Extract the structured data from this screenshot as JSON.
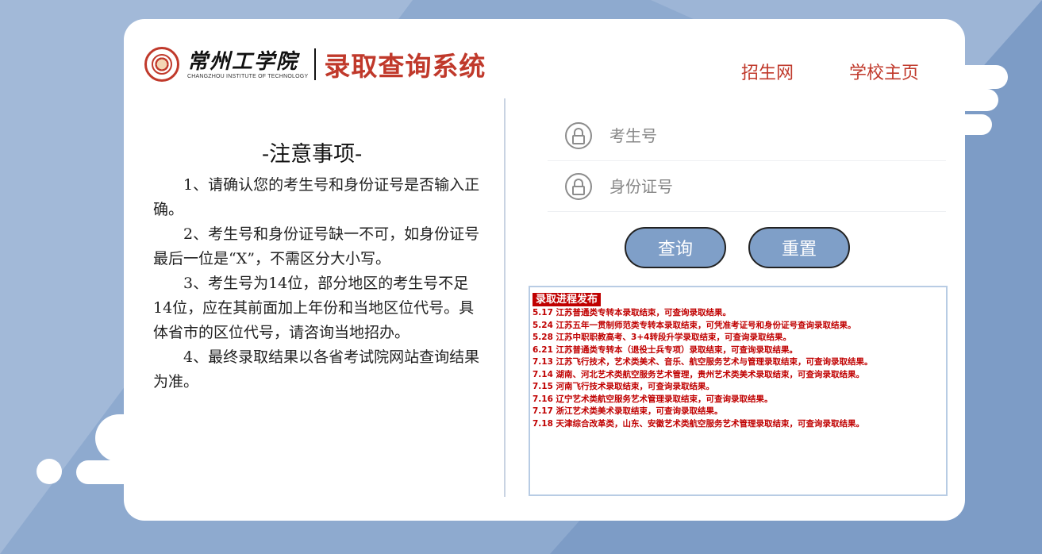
{
  "header": {
    "school_name_cn": "常州工学院",
    "school_name_en": "CHANGZHOU INSTITUTE OF TECHNOLOGY",
    "system_title": "录取查询系统",
    "seal_icon": "school-seal-icon"
  },
  "nav": {
    "items": [
      {
        "label": "招生网"
      },
      {
        "label": "学校主页"
      }
    ]
  },
  "notes": {
    "title": "-注意事项-",
    "items": [
      "1、请确认您的考生号和身份证号是否输入正确。",
      "2、考生号和身份证号缺一不可，如身份证号最后一位是“X”，不需区分大小写。",
      "3、考生号为14位，部分地区的考生号不足14位，应在其前面加上年份和当地区位代号。具体省市的区位代号，请咨询当地招办。",
      "4、最终录取结果以各省考试院网站查询结果为准。"
    ]
  },
  "form": {
    "exam_no_placeholder": "考生号",
    "id_no_placeholder": "身份证号",
    "exam_no_value": "",
    "id_no_value": "",
    "query_label": "查询",
    "reset_label": "重置",
    "field_icon": "lock-icon"
  },
  "news": {
    "heading": "录取进程发布",
    "items": [
      "5.17 江苏普通类专转本录取结束，可查询录取结果。",
      "5.24 江苏五年一贯制师范类专转本录取结束，可凭准考证号和身份证号查询录取结果。",
      "5.28 江苏中职职教高考、3+4转段升学录取结束，可查询录取结果。",
      "6.21 江苏普通类专转本（退役士兵专项）录取结束，可查询录取结果。",
      "7.13 江苏飞行技术，艺术类美术、音乐、航空服务艺术与管理录取结束，可查询录取结果。",
      "7.14 湖南、河北艺术类航空服务艺术管理，贵州艺术类美术录取结束，可查询录取结果。",
      "7.15 河南飞行技术录取结束，可查询录取结果。",
      "7.16 辽宁艺术类航空服务艺术管理录取结束，可查询录取结果。",
      "7.17 浙江艺术类美术录取结束，可查询录取结果。",
      "7.18 天津综合改革类，山东、安徽艺术类航空服务艺术管理录取结束，可查询录取结果。"
    ]
  },
  "colors": {
    "accent_red": "#c0392b",
    "news_red": "#c00000",
    "button_blue": "#7f9fc8",
    "background_blue": "#8eaacf"
  }
}
